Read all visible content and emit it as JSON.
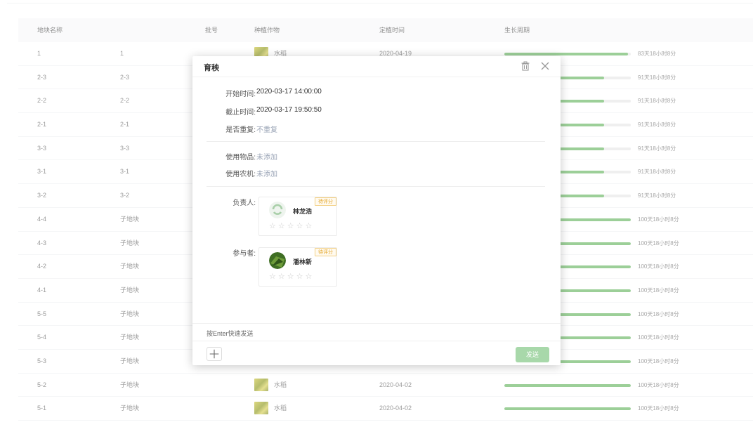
{
  "table": {
    "headers": [
      "地块名称",
      "",
      "批号",
      "种植作物",
      "定植时间",
      "生长周期"
    ],
    "rows": [
      {
        "name": "1",
        "sub": "1",
        "crop": "水稻",
        "date": "2020-04-19",
        "progress": 0.98,
        "cycle": "83天18小时8分"
      },
      {
        "name": "2-3",
        "sub": "2-3",
        "crop": "",
        "date": "",
        "progress": 0.79,
        "cycle": "91天18小时8分"
      },
      {
        "name": "2-2",
        "sub": "2-2",
        "crop": "",
        "date": "",
        "progress": 0.79,
        "cycle": "91天18小时8分"
      },
      {
        "name": "2-1",
        "sub": "2-1",
        "crop": "",
        "date": "",
        "progress": 0.79,
        "cycle": "91天18小时8分"
      },
      {
        "name": "3-3",
        "sub": "3-3",
        "crop": "",
        "date": "",
        "progress": 0.79,
        "cycle": "91天18小时8分"
      },
      {
        "name": "3-1",
        "sub": "3-1",
        "crop": "",
        "date": "",
        "progress": 0.79,
        "cycle": "91天18小时8分"
      },
      {
        "name": "3-2",
        "sub": "3-2",
        "crop": "",
        "date": "",
        "progress": 0.79,
        "cycle": "91天18小时8分"
      },
      {
        "name": "4-4",
        "sub": "子地块",
        "crop": "",
        "date": "",
        "progress": 1.0,
        "cycle": "100天18小时8分"
      },
      {
        "name": "4-3",
        "sub": "子地块",
        "crop": "",
        "date": "",
        "progress": 1.0,
        "cycle": "100天18小时8分"
      },
      {
        "name": "4-2",
        "sub": "子地块",
        "crop": "",
        "date": "",
        "progress": 1.0,
        "cycle": "100天18小时8分"
      },
      {
        "name": "4-1",
        "sub": "子地块",
        "crop": "",
        "date": "",
        "progress": 1.0,
        "cycle": "100天18小时8分"
      },
      {
        "name": "5-5",
        "sub": "子地块",
        "crop": "",
        "date": "",
        "progress": 1.0,
        "cycle": "100天18小时8分"
      },
      {
        "name": "5-4",
        "sub": "子地块",
        "crop": "",
        "date": "",
        "progress": 1.0,
        "cycle": "100天18小时8分"
      },
      {
        "name": "5-3",
        "sub": "子地块",
        "crop": "",
        "date": "",
        "progress": 1.0,
        "cycle": "100天18小时8分"
      },
      {
        "name": "5-2",
        "sub": "子地块",
        "crop": "水稻",
        "date": "2020-04-02",
        "progress": 1.0,
        "cycle": "100天18小时8分"
      },
      {
        "name": "5-1",
        "sub": "子地块",
        "crop": "水稻",
        "date": "2020-04-02",
        "progress": 1.0,
        "cycle": "100天18小时8分"
      }
    ]
  },
  "modal": {
    "title": "育秧",
    "start_label": "开始时间:",
    "start_value": "2020-03-17 14:00:00",
    "end_label": "截止时间:",
    "end_value": "2020-03-17 19:50:50",
    "repeat_label": "是否重复:",
    "repeat_value": "不重复",
    "items_label": "使用物品:",
    "items_value": "未添加",
    "machines_label": "使用农机:",
    "machines_value": "未添加",
    "owner_label": "负责人:",
    "owner": {
      "name": "林龙浩",
      "badge": "待评分",
      "rating": 0
    },
    "participant_label": "参与者:",
    "participant": {
      "name": "潘林新",
      "badge": "待评分",
      "rating": 0
    },
    "hint": "按Enter快速发送",
    "send_label": "发送"
  },
  "icons": {
    "trash": "trash-icon",
    "close": "close-icon",
    "add": "plus-icon",
    "star": "star-outline-icon"
  },
  "colors": {
    "progress": "#67b662",
    "send_button": "#a8d8aa",
    "badge": "#e4a72a",
    "link_muted": "#9aa4b6"
  }
}
